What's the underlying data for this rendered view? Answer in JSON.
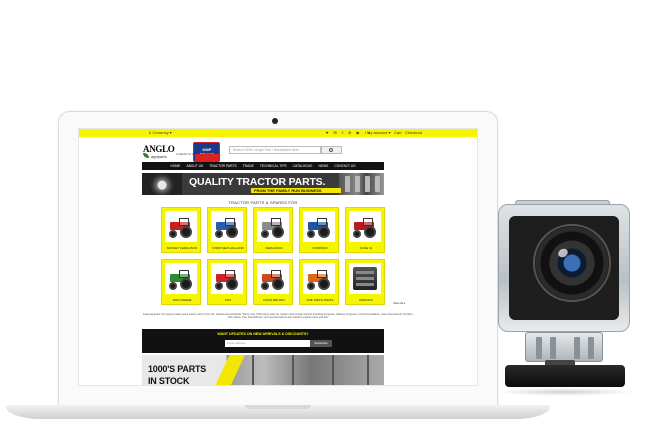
{
  "topbar": {
    "currency": "£ Currency ▾",
    "social": "♥ ✉ f ⊕ ▶ in",
    "account": "My account ▾",
    "cart": "Cart",
    "checkout": "Checkout"
  },
  "header": {
    "logo_main": "ANGLO",
    "logo_sub": "agriparts",
    "tagline": "A WEALTH OF KNOWLEDGE",
    "brand_badge": "KMP BRAND",
    "search_placeholder": "Search OEM / Anglo Part / Description Here"
  },
  "nav": [
    "HOME",
    "ABOUT US",
    "TRACTOR PARTS",
    "TRADE",
    "TECHNICAL TIPS",
    "CATALOGUE",
    "NEWS",
    "CONTACT US"
  ],
  "banner": {
    "title": "QUALITY TRACTOR PARTS.",
    "subtitle": "FROM THE FAMILY RUN BUSINESS"
  },
  "section_title": "TRACTOR PARTS & SPARES FOR",
  "products": [
    {
      "label": "MASSEY FERGUSON",
      "color": "#c8201f"
    },
    {
      "label": "FORD NEW HOLLAND",
      "color": "#2a5da8"
    },
    {
      "label": "FERGUSON",
      "color": "#8c8c8c"
    },
    {
      "label": "FORDSON",
      "color": "#1f56a3"
    },
    {
      "label": "CASE IH",
      "color": "#b51d1d"
    },
    {
      "label": "JOHN DEERE",
      "color": "#2e8b2e"
    },
    {
      "label": "FIAT",
      "color": "#cc2424"
    },
    {
      "label": "DAVID BROWN",
      "color": "#c94a1f"
    },
    {
      "label": "PRE 1960'S PARTS",
      "color": "#d86a1a"
    },
    {
      "label": "PERKINS",
      "color": "#333333"
    }
  ],
  "view_all": "View ALL",
  "description": "Anglo Agriparts UK supply quality spare tractor parts to the UK, Ireland and worldwide. We've over 7000 spare parts for modern and vintage tractors including Ferguson, Massey Ferguson, Ford New Holland, Case International, Fordson, John Deere, Fiat, David Brown, and several tractors plus Perkins engines parts and kits.",
  "newsletter": {
    "heading": "WANT UPDATES ON NEW ARRIVALS & DISCOUNTS?",
    "placeholder": "email address",
    "button": "Subscribe"
  },
  "promo": {
    "line1": "1000'S PARTS",
    "line2": "IN STOCK"
  }
}
